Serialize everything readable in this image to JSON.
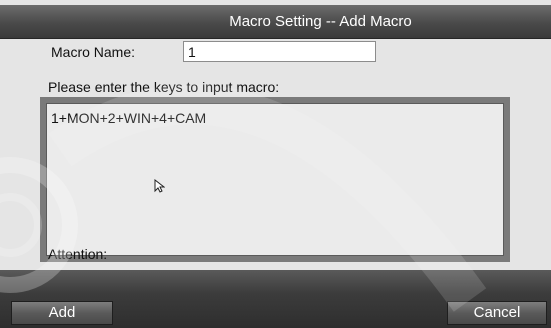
{
  "dialog": {
    "title": "Macro Setting -- Add Macro"
  },
  "form": {
    "name_label": "Macro Name:",
    "name_value": "1",
    "prompt_label": "Please enter the keys to input macro:",
    "macro_value": "1+MON+2+WIN+4+CAM",
    "attention_label": "Attention:"
  },
  "buttons": {
    "add_label": "Add",
    "cancel_label": "Cancel"
  },
  "icons": {
    "cursor": "mouse-pointer-icon"
  }
}
